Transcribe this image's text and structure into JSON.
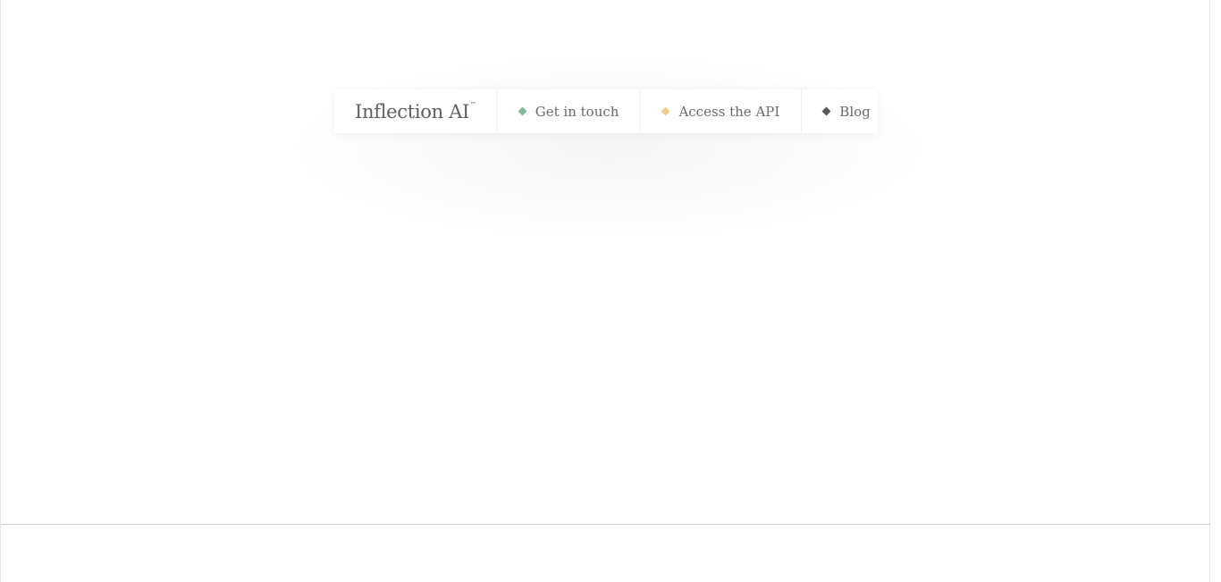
{
  "header": {
    "brand": "Inflection AI",
    "brand_mark": "™"
  },
  "nav": {
    "items": [
      {
        "label": "Get in touch",
        "color": "#7dbb95"
      },
      {
        "label": "Access the API",
        "color": "#f2c98f"
      },
      {
        "label": "Blog",
        "color": "#555555"
      }
    ]
  }
}
